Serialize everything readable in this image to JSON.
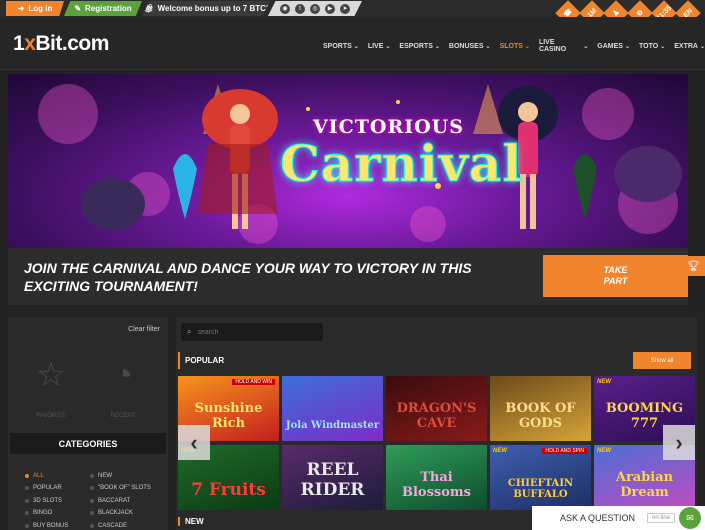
{
  "topbar": {
    "login_label": "Log in",
    "register_label": "Registration",
    "bonus_label": "Welcome bonus up to 7 BTC!",
    "socials": [
      "rss-icon",
      "twitter-icon",
      "instagram-icon",
      "youtube-icon",
      "telegram-icon"
    ],
    "corner_icons": [
      {
        "name": "phone-icon",
        "text": "☎"
      },
      {
        "name": "app-icon",
        "text": "1M"
      },
      {
        "name": "user-icon",
        "text": "♟"
      },
      {
        "name": "settings-icon",
        "text": "⚙"
      },
      {
        "name": "clock-icon",
        "text": "11:35"
      },
      {
        "name": "language-flag-icon",
        "text": "EN"
      }
    ]
  },
  "header": {
    "logo_prefix": "1",
    "logo_x": "x",
    "logo_suffix": "Bit.com",
    "nav": [
      {
        "label": "SPORTS",
        "active": false
      },
      {
        "label": "LIVE",
        "active": false
      },
      {
        "label": "ESPORTS",
        "active": false
      },
      {
        "label": "BONUSES",
        "active": false
      },
      {
        "label": "SLOTS",
        "active": true
      },
      {
        "label": "LIVE CASINO",
        "active": false
      },
      {
        "label": "GAMES",
        "active": false
      },
      {
        "label": "TOTO",
        "active": false
      },
      {
        "label": "EXTRA",
        "active": false
      }
    ]
  },
  "banner": {
    "title_small": "VICTORIOUS",
    "title_big": "Carnival"
  },
  "promo": {
    "text": "JOIN THE CARNIVAL AND DANCE YOUR WAY TO VICTORY IN THIS EXCITING TOURNAMENT!",
    "button_line1": "TAKE",
    "button_line2": "PART"
  },
  "sidebar": {
    "clear_filter": "Clear filter",
    "favorites_label": "FAVORITE",
    "recent_label": "RECENT",
    "categories_title": "CATEGORIES",
    "categories_left": [
      "ALL",
      "POPULAR",
      "3D SLOTS",
      "BINGO",
      "BUY BONUS"
    ],
    "categories_right": [
      "NEW",
      "\"BOOK OF\" SLOTS",
      "BACCARAT",
      "BLACKJACK",
      "CASCADE"
    ],
    "active_category": "ALL"
  },
  "main": {
    "search_placeholder": "search",
    "popular_title": "POPULAR",
    "show_all": "Show all",
    "new_title": "NEW",
    "games": [
      {
        "title": "Sunshine Rich",
        "colors": [
          "#f7941d",
          "#c41e1e"
        ],
        "text_color": "#ffe66d",
        "badge": "HOLD AND WIN",
        "new": false
      },
      {
        "title": "Jola Windmaster",
        "colors": [
          "#3b6fd9",
          "#7e2bc7"
        ],
        "text_color": "#9fe3ff",
        "badge": "",
        "new": false
      },
      {
        "title": "DRAGON'S CAVE",
        "colors": [
          "#3a0c0c",
          "#8a1a1a"
        ],
        "text_color": "#e14b3b",
        "badge": "",
        "new": false
      },
      {
        "title": "BOOK OF GODS",
        "colors": [
          "#6b4a1c",
          "#d8a437"
        ],
        "text_color": "#ffe08a",
        "badge": "",
        "new": false
      },
      {
        "title": "BOOMING 777",
        "colors": [
          "#5a1f8a",
          "#2c0e55"
        ],
        "text_color": "#ffd54a",
        "badge": "",
        "new": true
      },
      {
        "title": "7 Fruits",
        "colors": [
          "#1f6b2a",
          "#0b3a14"
        ],
        "text_color": "#ff3b3b",
        "badge": "",
        "new": true
      },
      {
        "title": "REEL RIDER",
        "colors": [
          "#5a2a6a",
          "#1c1c3a"
        ],
        "text_color": "#e8e8e8",
        "badge": "",
        "new": false
      },
      {
        "title": "Thai Blossoms",
        "colors": [
          "#2f9c5a",
          "#0f4c2c"
        ],
        "text_color": "#f7a6e0",
        "badge": "",
        "new": false
      },
      {
        "title": "CHIEFTAIN BUFFALO",
        "colors": [
          "#3f5fb0",
          "#1d2e63"
        ],
        "text_color": "#ffcc40",
        "badge": "HOLD AND SPIN",
        "new": true
      },
      {
        "title": "Arabian Dream",
        "colors": [
          "#4a6fd6",
          "#c24bbf"
        ],
        "text_color": "#ffd54a",
        "badge": "",
        "new": true
      }
    ]
  },
  "chat": {
    "ask_label": "ASK A QUESTION",
    "status": "on-line"
  }
}
